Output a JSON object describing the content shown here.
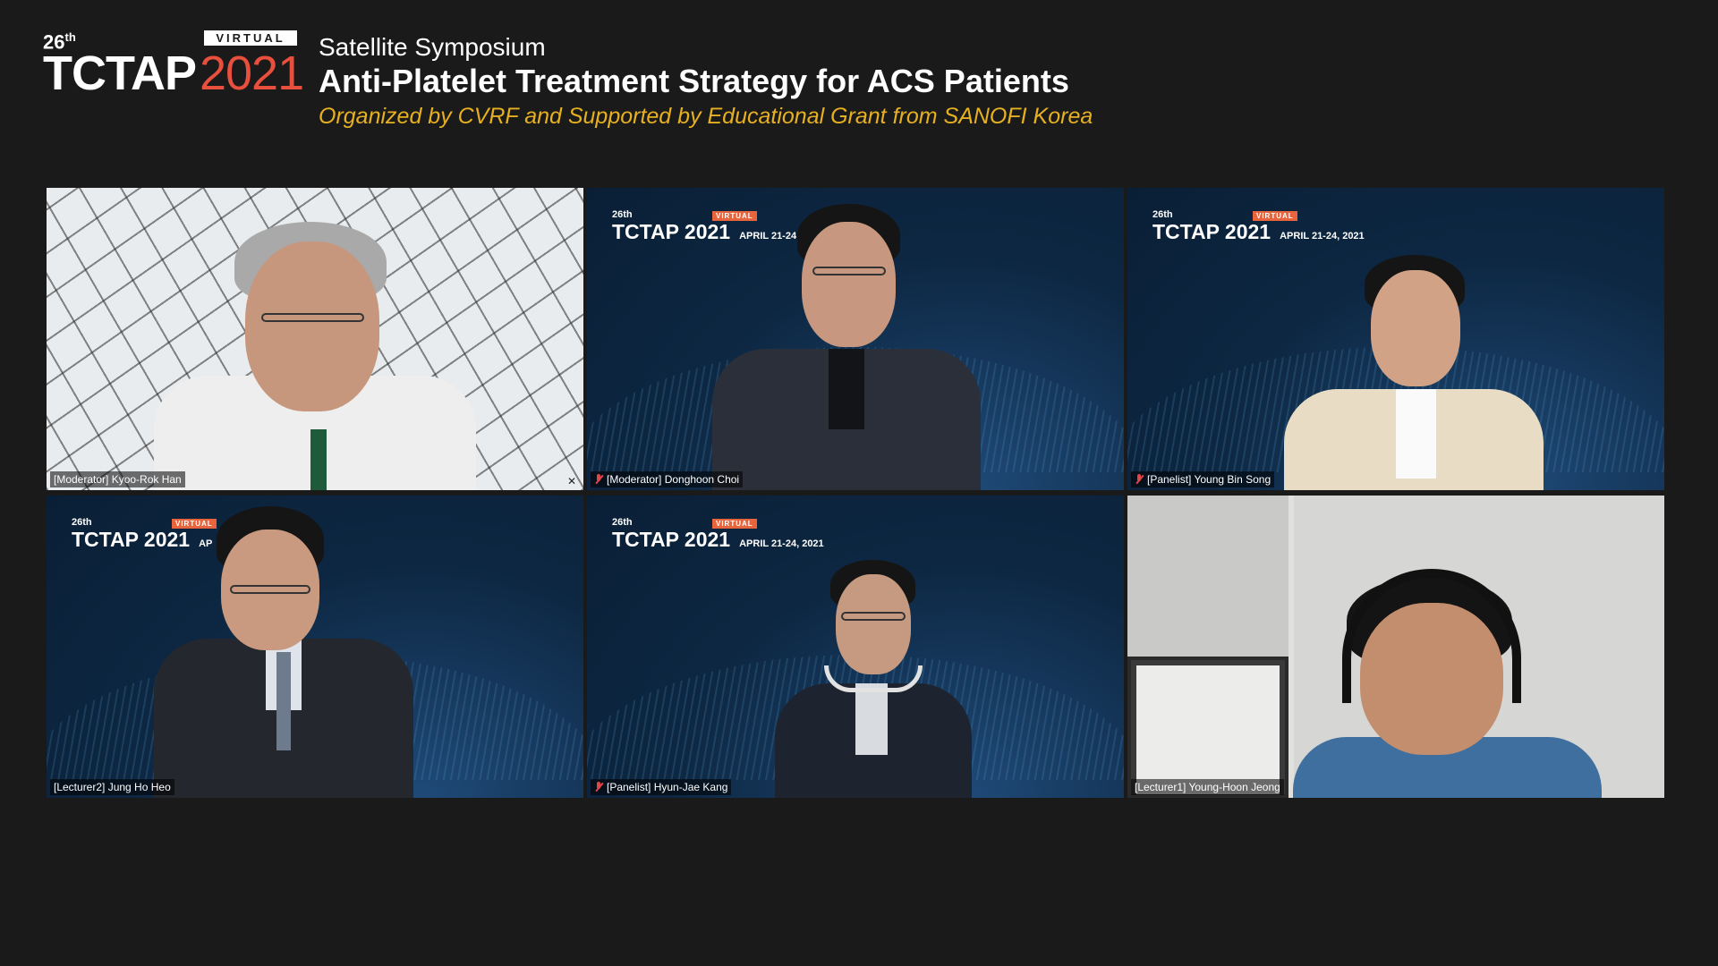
{
  "header": {
    "edition": "26",
    "edition_suffix": "th",
    "virtual_badge": "VIRTUAL",
    "brand_name": "TCTAP",
    "brand_year": "2021",
    "subtitle": "Satellite Symposium",
    "title": "Anti-Platelet Treatment Strategy for ACS Patients",
    "organizer": "Organized by CVRF and Supported by Educational Grant from SANOFI Korea"
  },
  "colors": {
    "background": "#1a1a1a",
    "accent_red": "#e84f3c",
    "accent_gold": "#e6b021",
    "active_speaker_border": "#e6e04d",
    "muted_icon": "#e04848"
  },
  "banner": {
    "edition": "26th",
    "virtual": "VIRTUAL",
    "brand": "TCTAP 2021",
    "date_short": "APRIL 21-24",
    "date_full": "APRIL 21-24, 2021",
    "date_cut": "AP"
  },
  "participants": [
    {
      "name": "[Moderator] Kyoo-Rok Han",
      "muted": false,
      "active": true
    },
    {
      "name": "[Moderator] Donghoon Choi",
      "muted": true,
      "active": false
    },
    {
      "name": "[Panelist] Young Bin Song",
      "muted": true,
      "active": false
    },
    {
      "name": "[Lecturer2] Jung Ho Heo",
      "muted": false,
      "active": false
    },
    {
      "name": "[Panelist] Hyun-Jae Kang",
      "muted": true,
      "active": false
    },
    {
      "name": "[Lecturer1] Young-Hoon Jeong",
      "muted": false,
      "active": false
    }
  ]
}
